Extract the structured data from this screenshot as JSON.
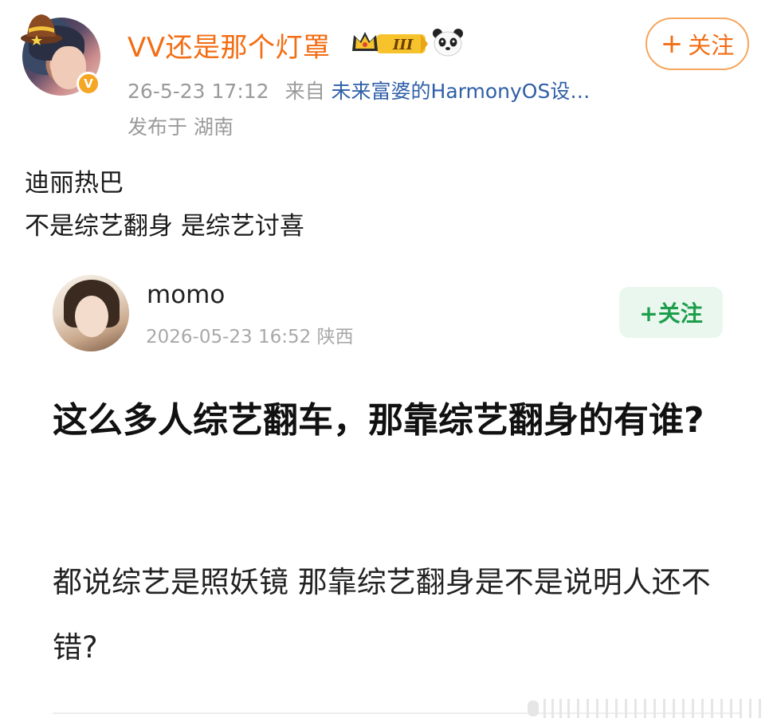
{
  "post": {
    "author": {
      "name": "VV还是那个灯罩",
      "verified_badge": "V"
    },
    "level_badge": "III",
    "meta": {
      "time": "26-5-23 17:12",
      "from_label": "来自",
      "source": "未来富婆的HarmonyOS设…",
      "location": "发布于 湖南"
    },
    "follow": {
      "plus": "+",
      "label": "关注"
    },
    "text_lines": [
      "迪丽热巴",
      "不是综艺翻身 是综艺讨喜"
    ]
  },
  "embed": {
    "name": "momo",
    "meta": "2026-05-23 16:52  陕西",
    "follow_label": "+关注",
    "title": "这么多人综艺翻车，那靠综艺翻身的有谁?",
    "body": "都说综艺是照妖镜 那靠综艺翻身是不是说明人还不错?"
  },
  "colors": {
    "username": "#f26d13",
    "source_link": "#2f5fa7",
    "meta_gray": "#9a9a9a",
    "follow_border": "#f7a65d",
    "embed_follow_bg": "#eaf7ee",
    "embed_follow_text": "#1d9e4c"
  },
  "icons": [
    "lucky-hat-icon",
    "verified-v-icon",
    "crown-level-icon",
    "panda-icon"
  ]
}
